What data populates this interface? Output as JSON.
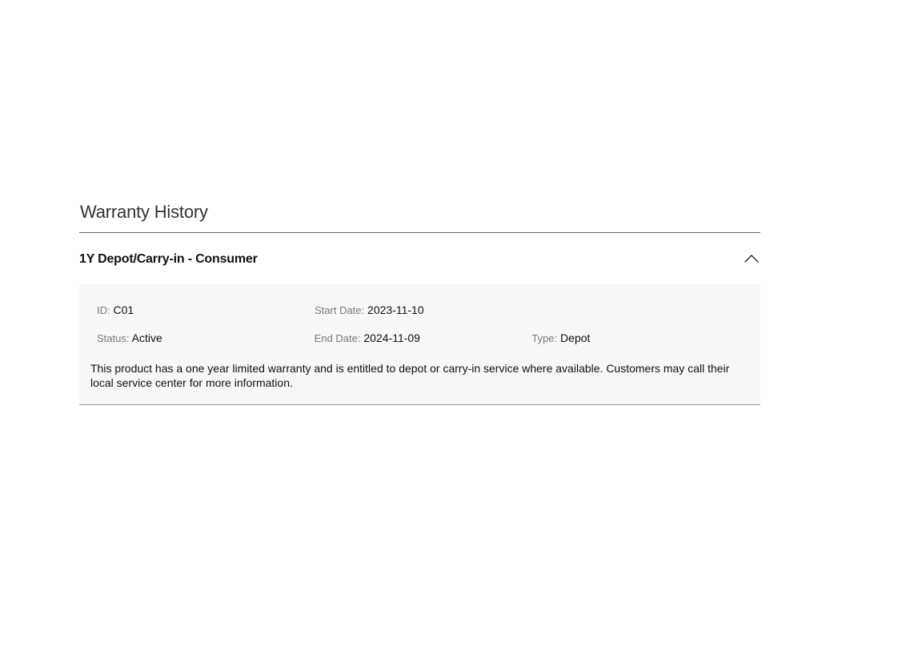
{
  "section": {
    "title": "Warranty History"
  },
  "warranty": {
    "title": "1Y Depot/Carry-in - Consumer",
    "expanded": true,
    "fields": {
      "id_label": "ID",
      "id_value": "C01",
      "start_label": "Start Date",
      "start_value": "2023-11-10",
      "status_label": "Status",
      "status_value": "Active",
      "end_label": "End Date",
      "end_value": "2024-11-09",
      "type_label": "Type",
      "type_value": "Depot"
    },
    "description": "This product has a one year limited warranty and is entitled to depot or carry-in service where available. Customers may call their local service center for more information."
  },
  "icons": {
    "collapse": "chevron-up-icon"
  },
  "colors": {
    "panel_background": "#f7f7f7",
    "rule": "#6b6b6b",
    "label_gray": "#7a7a7a"
  }
}
